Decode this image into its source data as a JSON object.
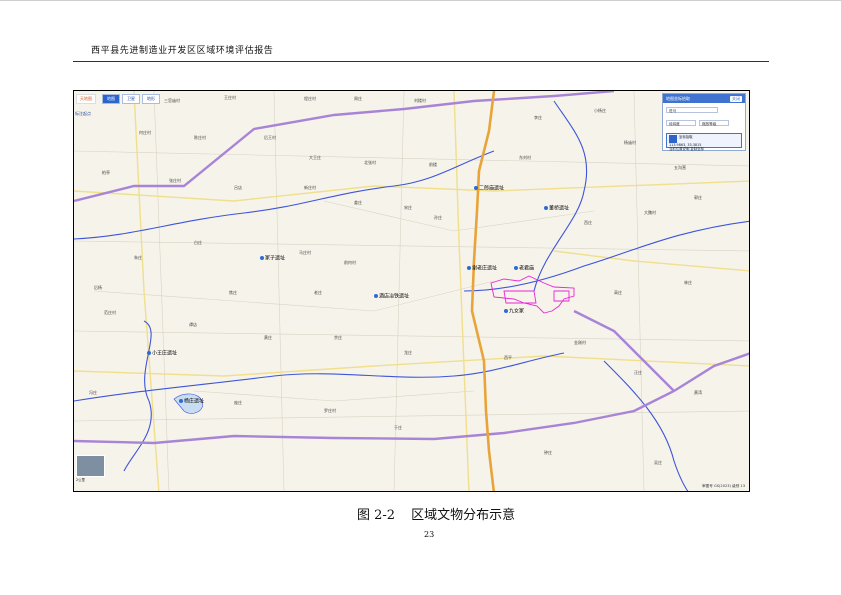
{
  "document": {
    "header_title": "西平县先进制造业开发区区域环境评估报告",
    "figure_number": "图 2-2",
    "figure_caption": "区域文物分布示意",
    "page_number": "23"
  },
  "map_ui": {
    "logo": "天地图",
    "tabs": [
      "地图",
      "卫星",
      "地形"
    ],
    "start_button": "标注起点",
    "panel": {
      "title": "地图坐标拾取",
      "close_label": "关闭",
      "select_value": "驻马",
      "search_value": "经纬度",
      "zoom_value": "缩放等级",
      "coord_line1": "坐标拾取",
      "coord_line2": "113.9863, 33.3815",
      "coord_line3": "当前位置说明",
      "coord_line4": "复制坐标"
    },
    "scale_label": "2公里",
    "copyright": "审图号 GS(2023) 级别 13"
  },
  "colors": {
    "river": "#3e55d8",
    "expressway": "#e8a43a",
    "provincial_road": "#a884d6",
    "county_road": "#f0df8c",
    "dev_zone": "#e826d8",
    "background": "#f6f3ea"
  },
  "sites": [
    {
      "name": "二郎庙遗址",
      "type": "cultural-relic"
    },
    {
      "name": "董桥遗址",
      "type": "cultural-relic"
    },
    {
      "name": "冢子遗址",
      "type": "cultural-relic"
    },
    {
      "name": "谢老庄遗址",
      "type": "cultural-relic"
    },
    {
      "name": "酒店冶铁遗址",
      "type": "cultural-relic"
    },
    {
      "name": "老君庙",
      "type": "cultural-relic"
    },
    {
      "name": "小王庄遗址",
      "type": "cultural-relic"
    },
    {
      "name": "杨庄遗址",
      "type": "cultural-relic"
    },
    {
      "name": "九女冢",
      "type": "cultural-relic"
    }
  ],
  "places": [
    "三官庙村",
    "王庄村",
    "程庄村",
    "周庄",
    "刘楼村",
    "李庄",
    "小杨庄",
    "何庄村",
    "陈庄村",
    "后王村",
    "大王庄",
    "北张村",
    "前楼",
    "东刘村",
    "杨庙村",
    "五沟营",
    "柏亭",
    "张庄村",
    "吕店",
    "新庄村",
    "姜庄",
    "宋庄",
    "孙庄",
    "西庄",
    "大魏村",
    "郭庄",
    "朱庄",
    "白庄",
    "马庄村",
    "前何村",
    "后杨",
    "焦庄",
    "老庄",
    "高庄",
    "林庄",
    "范庄村",
    "谭店",
    "黄庄",
    "余庄",
    "龙庄",
    "西平",
    "金刚村",
    "汪庄",
    "黄湾",
    "冯庄",
    "庞庄",
    "罗庄村",
    "于庄",
    "钟庄",
    "吴庄"
  ]
}
